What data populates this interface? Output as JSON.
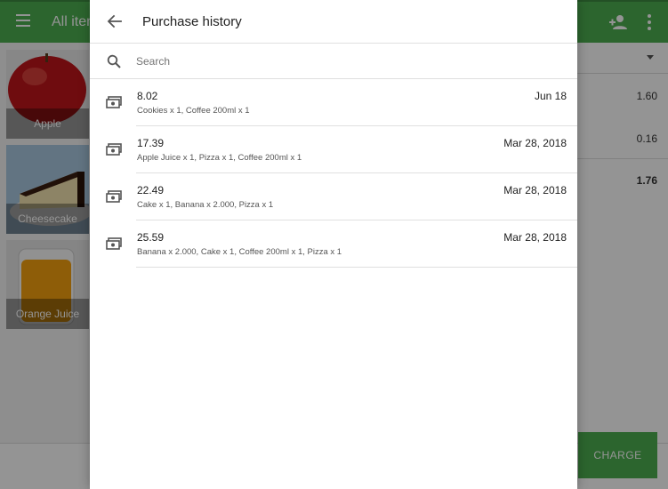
{
  "appbar": {
    "title": "All items"
  },
  "tiles": [
    {
      "label": "Apple"
    },
    {
      "label": "Cheesecake"
    },
    {
      "label": "Orange Juice"
    }
  ],
  "cart": {
    "amounts": [
      "1.60",
      "0.16",
      "1.76"
    ]
  },
  "charge_label": "CHARGE",
  "dialog": {
    "title": "Purchase history",
    "search_placeholder": "Search",
    "items": [
      {
        "amount": "8.02",
        "date": "Jun 18",
        "desc": "Cookies x 1, Coffee 200ml x 1"
      },
      {
        "amount": "17.39",
        "date": "Mar 28, 2018",
        "desc": "Apple Juice x 1, Pizza x 1, Coffee 200ml x 1"
      },
      {
        "amount": "22.49",
        "date": "Mar 28, 2018",
        "desc": "Cake x 1, Banana x 2.000, Pizza x 1"
      },
      {
        "amount": "25.59",
        "date": "Mar 28, 2018",
        "desc": "Banana x 2.000, Cake x 1, Coffee 200ml x 1, Pizza x 1"
      }
    ]
  },
  "colors": {
    "accent": "#4caf50",
    "scrim": "rgba(0,0,0,0.42)"
  },
  "icons": [
    "menu-icon",
    "add-person-icon",
    "more-vert-icon",
    "back-arrow-icon",
    "search-icon",
    "money-icon",
    "dropdown-arrow-icon"
  ]
}
